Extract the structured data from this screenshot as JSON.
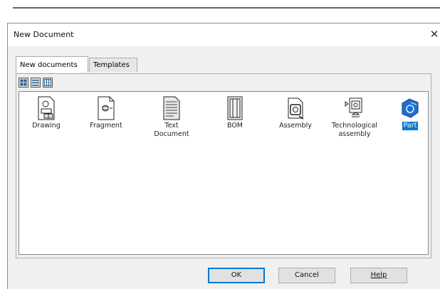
{
  "dialog": {
    "title": "New Document",
    "close_glyph": "✕"
  },
  "tabs": [
    {
      "label": "New documents"
    },
    {
      "label": "Templates"
    }
  ],
  "view_buttons": [
    "large-icons-icon",
    "list-icon",
    "details-icon"
  ],
  "documents": [
    {
      "label": "Drawing",
      "icon": "drawing-icon"
    },
    {
      "label": "Fragment",
      "icon": "fragment-icon"
    },
    {
      "label": "Text\nDocument",
      "icon": "text-document-icon"
    },
    {
      "label": "BOM",
      "icon": "bom-icon"
    },
    {
      "label": "Assembly",
      "icon": "assembly-icon"
    },
    {
      "label": "Technological\nassembly",
      "icon": "technological-assembly-icon"
    },
    {
      "label": "Part",
      "icon": "part-icon",
      "selected": true
    }
  ],
  "buttons": {
    "ok": "OK",
    "cancel": "Cancel",
    "help": "Help"
  },
  "colors": {
    "selection": "#0078d7",
    "dialog_bg": "#f0f0f0"
  }
}
